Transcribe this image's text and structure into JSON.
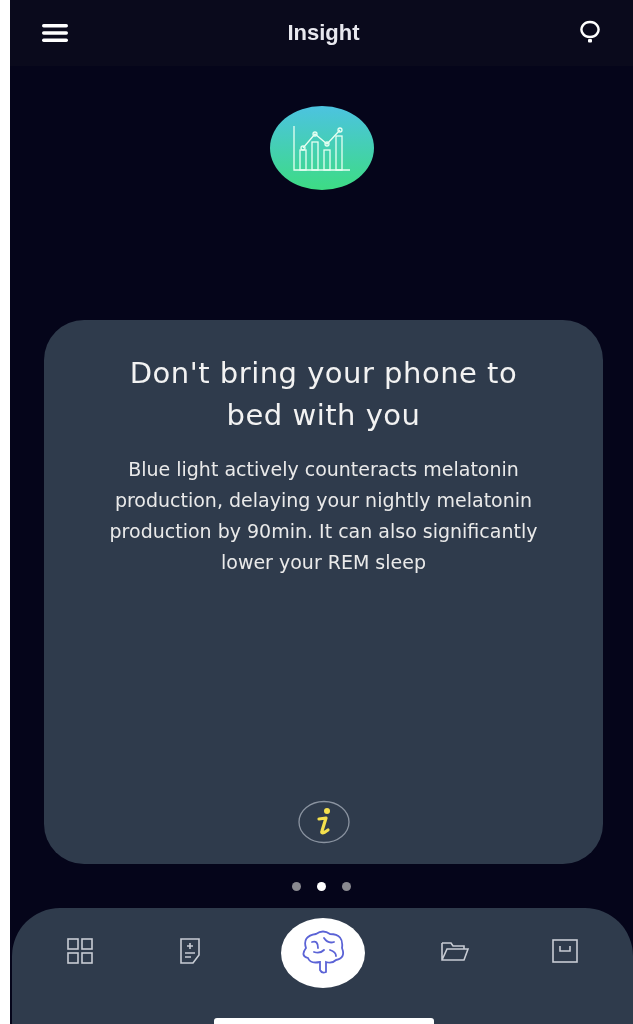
{
  "header": {
    "title": "Insight"
  },
  "tip": {
    "title": "Don't bring your phone to bed with you",
    "body": "Blue light actively counteracts melatonin production, delaying your nightly melatonin production by 90min. It can also significantly lower your REM sleep"
  },
  "pager": [
    {
      "selected": false
    },
    {
      "selected": true
    },
    {
      "selected": false
    }
  ],
  "nav": [
    {
      "kind": "grid",
      "selected": false
    },
    {
      "kind": "note",
      "selected": false
    },
    {
      "kind": "brain",
      "selected": true
    },
    {
      "kind": "folder",
      "selected": false
    },
    {
      "kind": "tray",
      "selected": false
    }
  ]
}
